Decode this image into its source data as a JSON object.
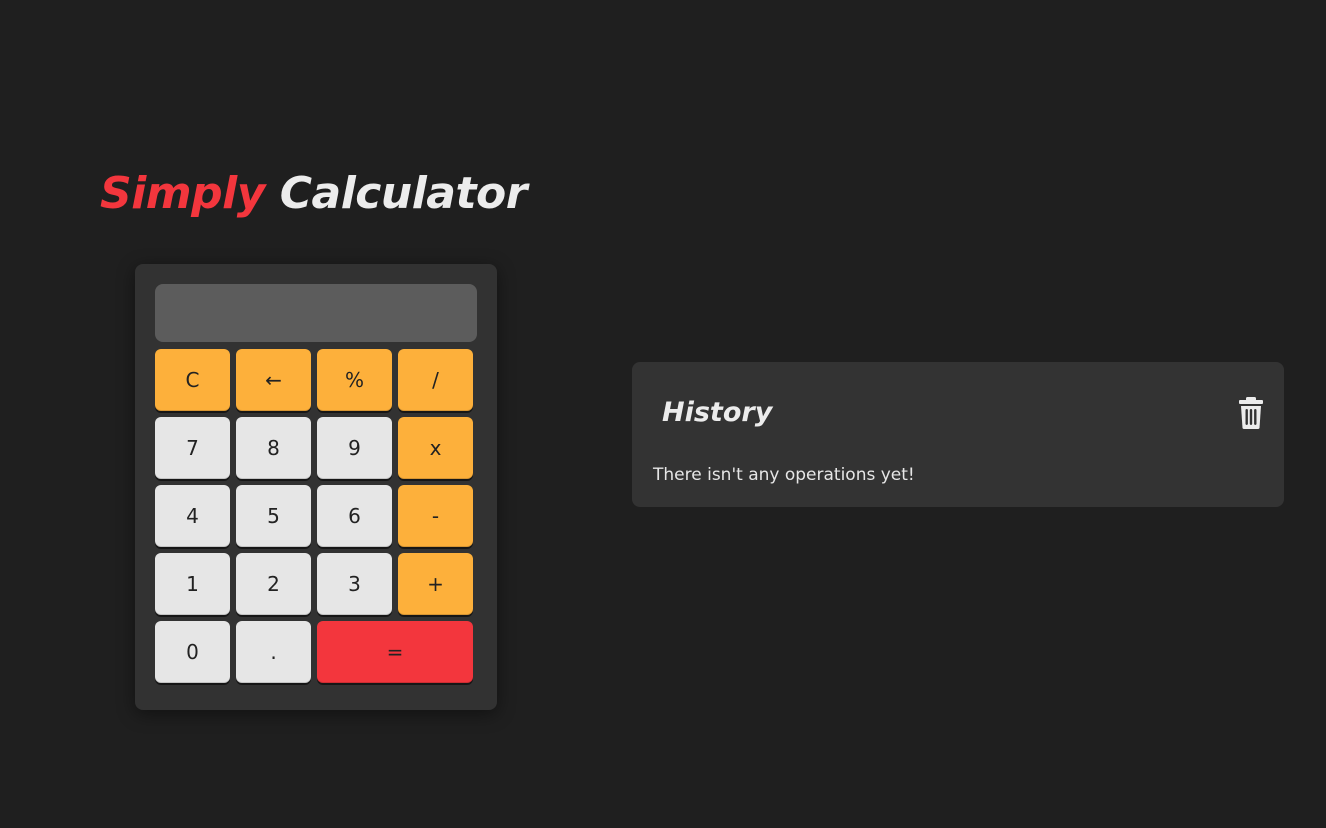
{
  "title": {
    "accent_word": "Simply",
    "main_word": "Calculator"
  },
  "calculator": {
    "display_value": "",
    "keys": [
      {
        "label": "C",
        "type": "op",
        "icon": ""
      },
      {
        "label": "←",
        "type": "op",
        "icon": "backspace-arrow-icon"
      },
      {
        "label": "%",
        "type": "op",
        "icon": ""
      },
      {
        "label": "/",
        "type": "op",
        "icon": ""
      },
      {
        "label": "7",
        "type": "num",
        "icon": ""
      },
      {
        "label": "8",
        "type": "num",
        "icon": ""
      },
      {
        "label": "9",
        "type": "num",
        "icon": ""
      },
      {
        "label": "x",
        "type": "op",
        "icon": ""
      },
      {
        "label": "4",
        "type": "num",
        "icon": ""
      },
      {
        "label": "5",
        "type": "num",
        "icon": ""
      },
      {
        "label": "6",
        "type": "num",
        "icon": ""
      },
      {
        "label": "-",
        "type": "op",
        "icon": ""
      },
      {
        "label": "1",
        "type": "num",
        "icon": ""
      },
      {
        "label": "2",
        "type": "num",
        "icon": ""
      },
      {
        "label": "3",
        "type": "num",
        "icon": ""
      },
      {
        "label": "+",
        "type": "op",
        "icon": ""
      },
      {
        "label": "0",
        "type": "num",
        "icon": ""
      },
      {
        "label": ".",
        "type": "num",
        "icon": ""
      },
      {
        "label": "=",
        "type": "eq",
        "icon": ""
      }
    ]
  },
  "history": {
    "title": "History",
    "empty_message": "There isn't any operations yet!",
    "clear_icon": "trash-icon"
  },
  "colors": {
    "background": "#1f1f1f",
    "accent_red": "#f3363d",
    "operator_orange": "#fdb03b",
    "number_key": "#e6e6e6",
    "panel": "#333333",
    "display": "#5c5c5c"
  }
}
